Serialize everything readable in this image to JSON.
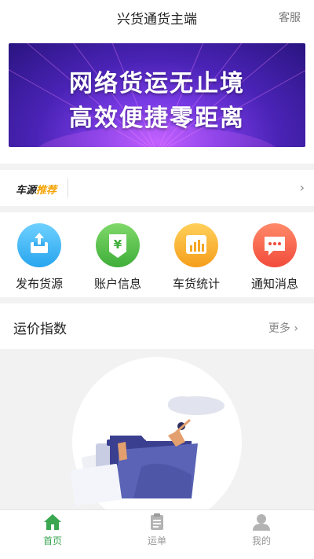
{
  "header": {
    "title": "兴货通货主端",
    "service_label": "客服"
  },
  "banner": {
    "line1": "网络货运无止境",
    "line2": "高效便捷零距离"
  },
  "recommend": {
    "logo_part1": "车源",
    "logo_part2": "推荐",
    "arrow": "›"
  },
  "quick_actions": [
    {
      "label": "发布货源",
      "icon": "upload-tray-icon",
      "color": "#27a5ee"
    },
    {
      "label": "账户信息",
      "icon": "yen-wallet-icon",
      "color": "#3fae39"
    },
    {
      "label": "车货统计",
      "icon": "bar-chart-icon",
      "color": "#f59e1c"
    },
    {
      "label": "通知消息",
      "icon": "chat-bubble-icon",
      "color": "#f24b3b"
    }
  ],
  "freight_index": {
    "title": "运价指数",
    "more_label": "更多 ›"
  },
  "tabbar": {
    "items": [
      {
        "label": "首页",
        "icon": "home-icon",
        "active": true
      },
      {
        "label": "运单",
        "icon": "clipboard-icon",
        "active": false
      },
      {
        "label": "我的",
        "icon": "user-icon",
        "active": false
      }
    ],
    "active_color": "#3aa650"
  }
}
